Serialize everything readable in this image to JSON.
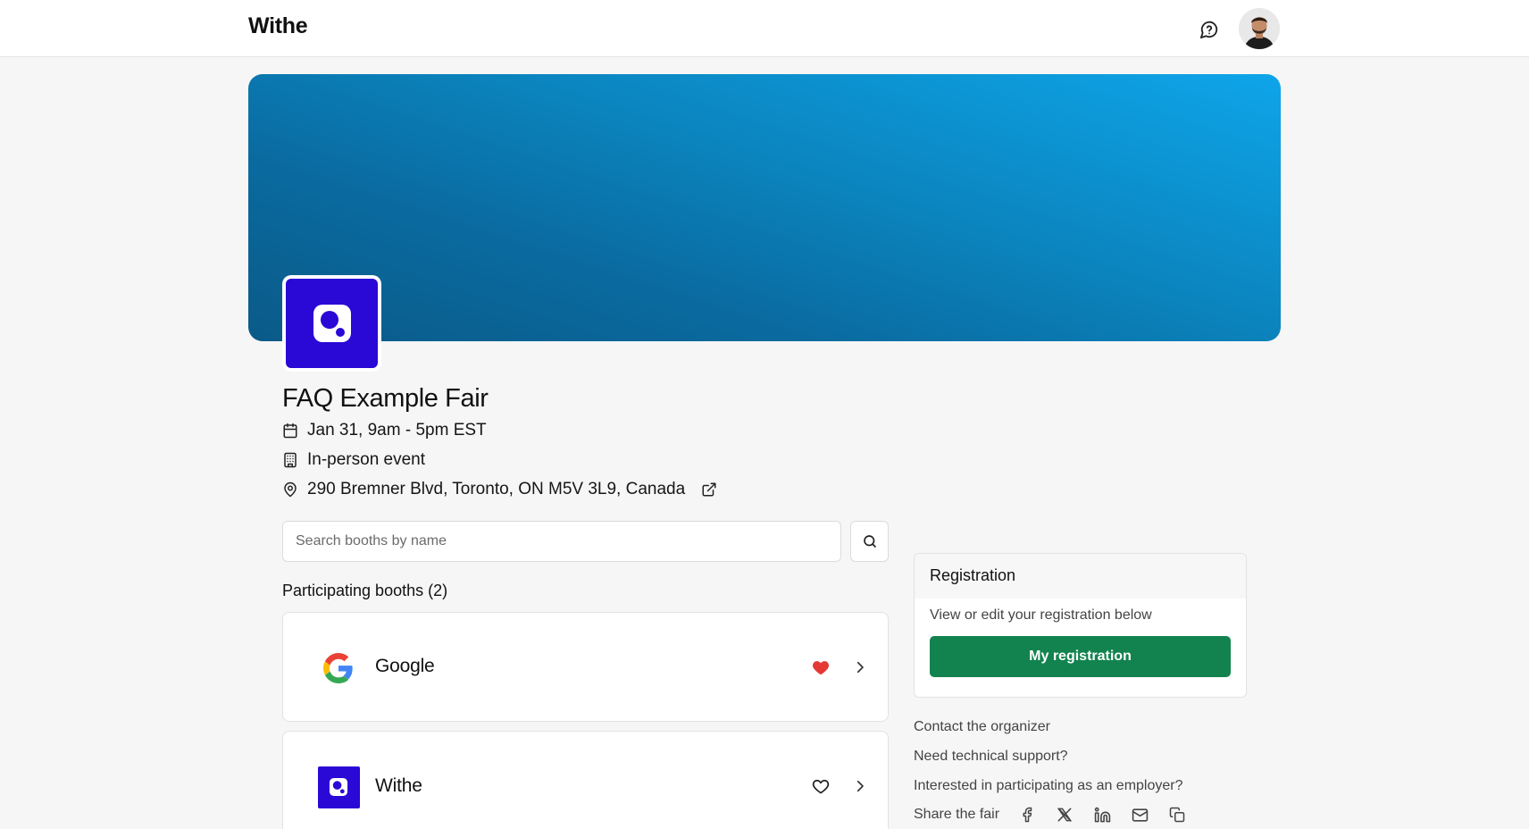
{
  "header": {
    "brand": "Withe"
  },
  "fair": {
    "title": "FAQ Example Fair",
    "date": "Jan 31, 9am - 5pm EST",
    "event_type": "In-person event",
    "address": "290 Bremner Blvd, Toronto, ON M5V 3L9, Canada",
    "brand_color": "#2a08d6",
    "banner_color": "#0a6a9f"
  },
  "search": {
    "placeholder": "Search booths by name",
    "value": ""
  },
  "booths": {
    "heading": "Participating booths (2)",
    "items": [
      {
        "name": "Google",
        "favorited": true,
        "logo": "google-logo"
      },
      {
        "name": "Withe",
        "favorited": false,
        "logo": "withe-logo"
      }
    ]
  },
  "registration": {
    "title": "Registration",
    "description": "View or edit your registration below",
    "button_label": "My registration",
    "button_color": "#12834f"
  },
  "links": {
    "contact": "Contact the organizer",
    "support": "Need technical support?",
    "employer": "Interested in participating as an employer?",
    "share_label": "Share the fair"
  },
  "icons": {
    "header": [
      "chat-help-icon",
      "avatar"
    ],
    "meta": [
      "calendar-icon",
      "building-icon",
      "map-pin-icon",
      "external-link-icon"
    ],
    "share": [
      "facebook-icon",
      "x-icon",
      "linkedin-icon",
      "mail-icon",
      "copy-icon"
    ]
  }
}
